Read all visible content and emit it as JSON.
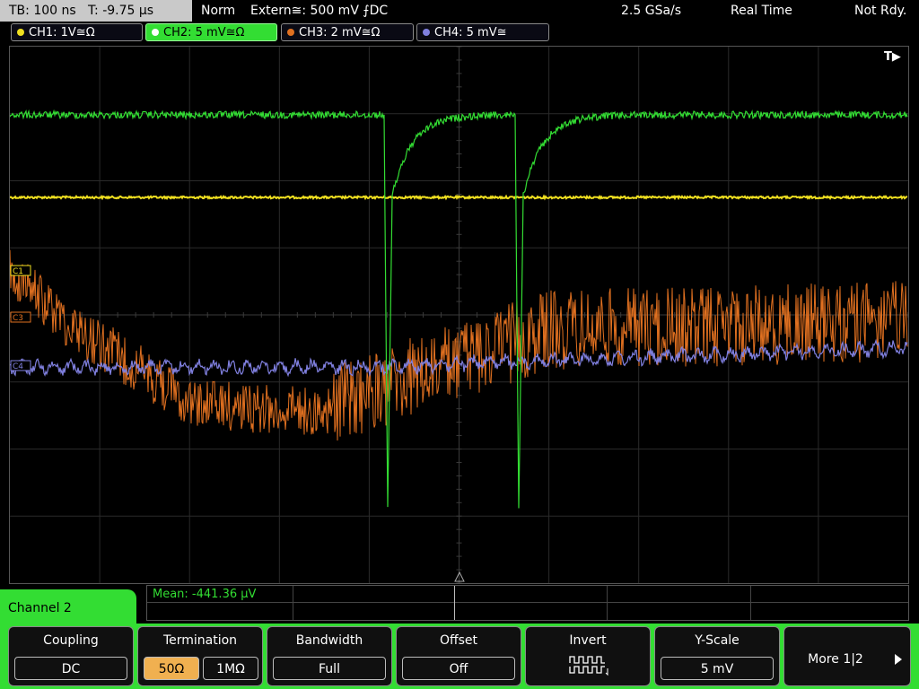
{
  "top_bar": {
    "timebase": "TB: 100 ns   T: -9.75 µs",
    "trigger_mode": "Norm",
    "trigger_source": "Extern≅: 500 mV ⨍DC",
    "sample_rate": "2.5 GSa/s",
    "acq_mode": "Real Time",
    "status": "Not Rdy."
  },
  "channels": [
    {
      "label": "CH1: 1V≅Ω",
      "color": "#f0e020"
    },
    {
      "label": "CH2: 5 mV≅Ω",
      "color": "#33dd33"
    },
    {
      "label": "CH3: 2 mV≅Ω",
      "color": "#e07020"
    },
    {
      "label": "CH4: 5 mV≅",
      "color": "#8080e0"
    }
  ],
  "markers": {
    "trigger_pos": "T▶",
    "c1": "C1",
    "c3": "C3",
    "c4": "C4"
  },
  "measurement": {
    "mean": "Mean: -441.36 µV"
  },
  "menu": {
    "title": "Channel 2"
  },
  "softkeys": {
    "coupling": {
      "title": "Coupling",
      "value": "DC"
    },
    "termination": {
      "title": "Termination",
      "opt1": "50Ω",
      "opt2": "1MΩ"
    },
    "bandwidth": {
      "title": "Bandwidth",
      "value": "Full"
    },
    "offset": {
      "title": "Offset",
      "value": "Off"
    },
    "invert": {
      "title": "Invert"
    },
    "yscale": {
      "title": "Y-Scale",
      "value": "5 mV"
    },
    "more": {
      "label": "More 1|2"
    }
  }
}
